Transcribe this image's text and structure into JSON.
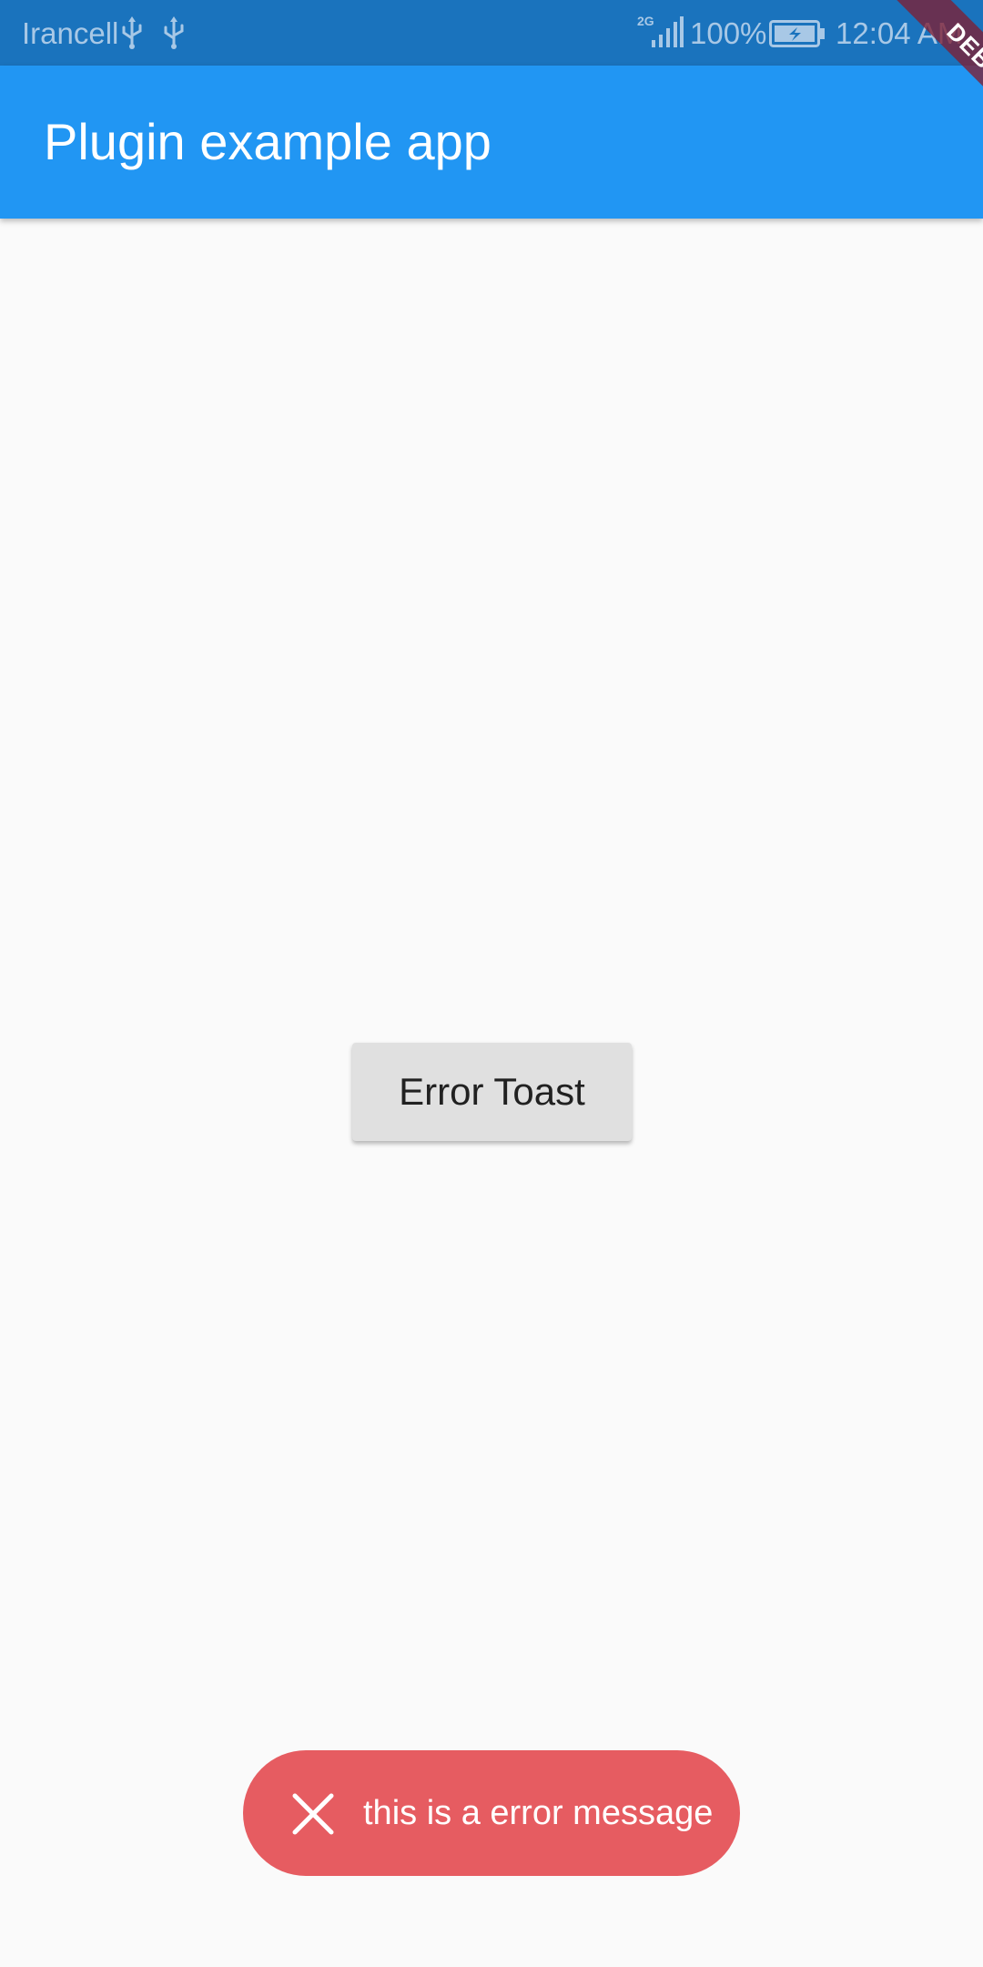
{
  "status_bar": {
    "carrier": "Irancell",
    "network_type": "2G",
    "battery": "100%",
    "time": "12:04 AM",
    "icons": [
      "usb-icon",
      "usb-icon",
      "signal-icon",
      "battery-charging-icon"
    ]
  },
  "app_bar": {
    "title": "Plugin example app",
    "color": "#2196f3"
  },
  "debug_banner": {
    "label": "DEBUG"
  },
  "main": {
    "error_button_label": "Error Toast"
  },
  "toast": {
    "message": "this is a error message",
    "icon": "close-icon",
    "color": "#e65c61"
  }
}
